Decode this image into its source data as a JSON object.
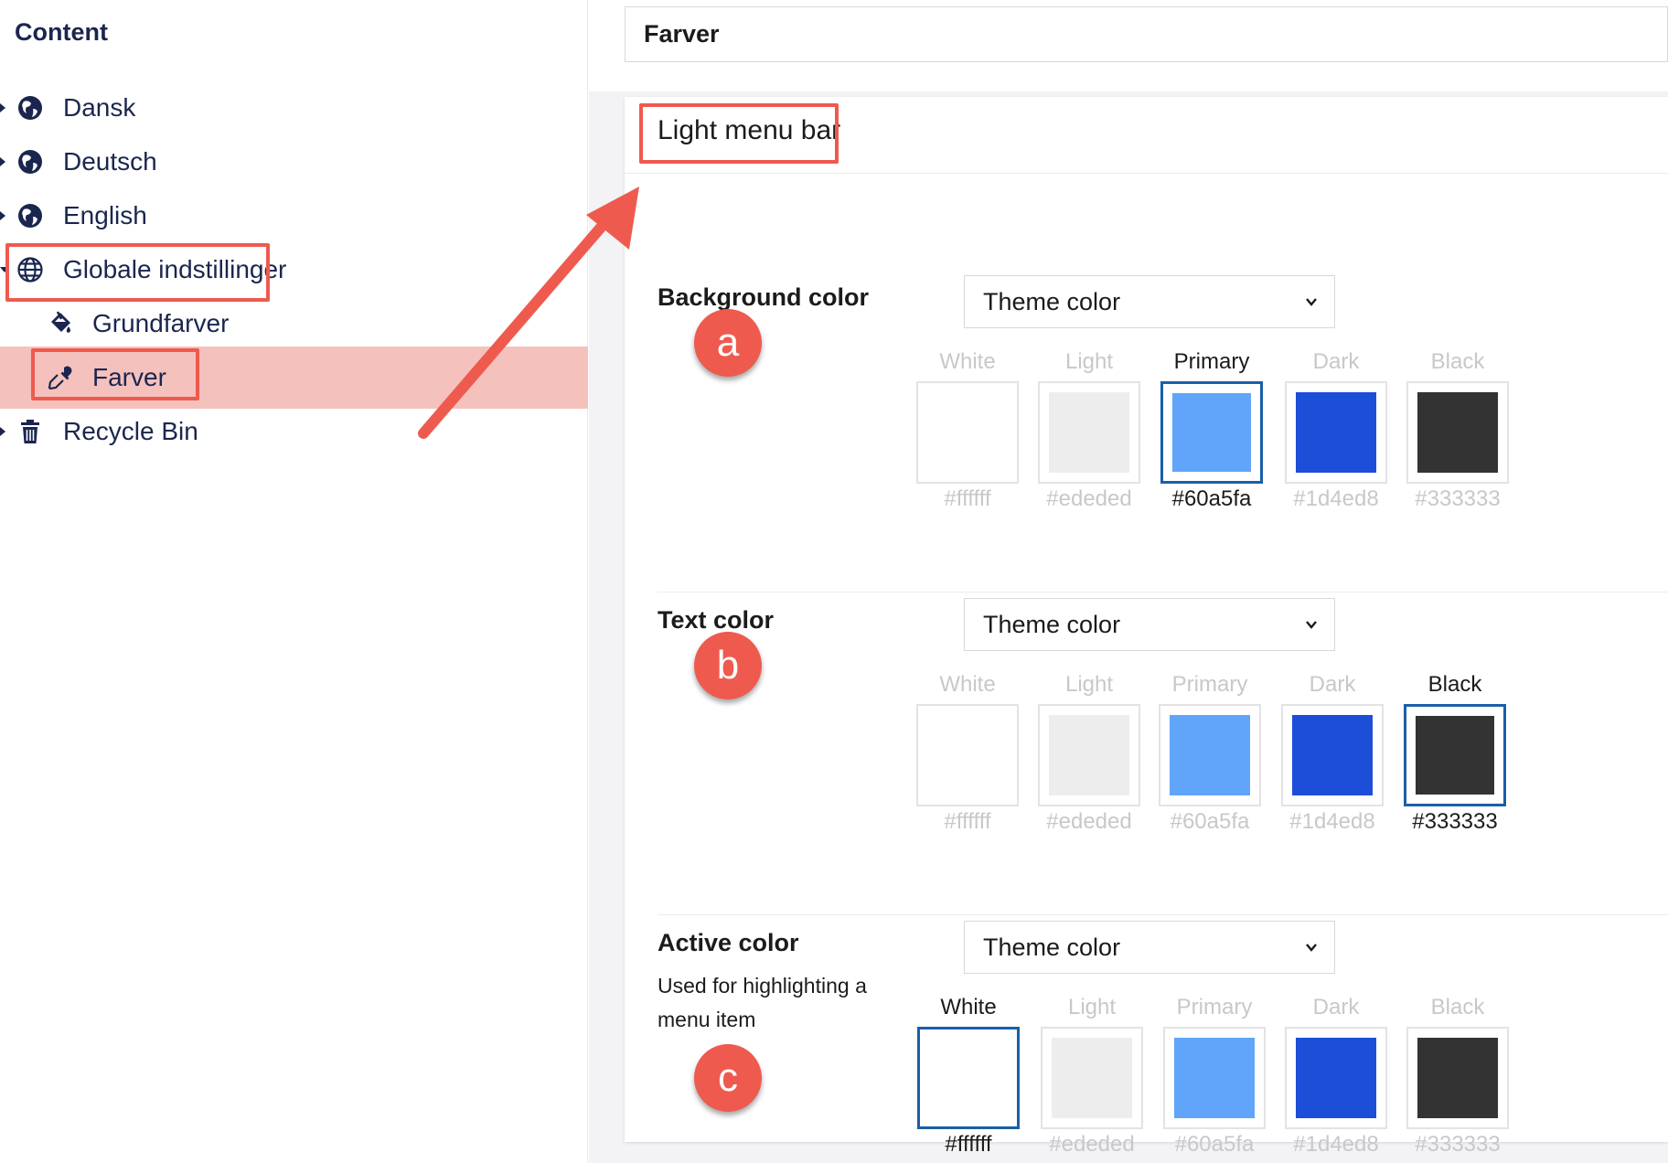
{
  "tree": {
    "title": "Content",
    "items": [
      {
        "label": "Dansk",
        "icon": "globe-icon"
      },
      {
        "label": "Deutsch",
        "icon": "globe-icon"
      },
      {
        "label": "English",
        "icon": "globe-icon"
      },
      {
        "label": "Globale indstillinger",
        "icon": "globe-grid-icon"
      },
      {
        "label": "Grundfarver",
        "icon": "paint-bucket-icon"
      },
      {
        "label": "Farver",
        "icon": "eyedropper-icon",
        "selected": true
      },
      {
        "label": "Recycle Bin",
        "icon": "trash-icon"
      }
    ]
  },
  "editor": {
    "node_name": "Farver",
    "group_title": "Light menu bar",
    "properties": [
      {
        "label": "Background color",
        "description": "",
        "select_value": "Theme color",
        "badge": "a",
        "swatches": [
          {
            "name": "White",
            "hex": "#ffffff",
            "selected": false
          },
          {
            "name": "Light",
            "hex": "#ededed",
            "selected": false
          },
          {
            "name": "Primary",
            "hex": "#60a5fa",
            "selected": true
          },
          {
            "name": "Dark",
            "hex": "#1d4ed8",
            "selected": false
          },
          {
            "name": "Black",
            "hex": "#333333",
            "selected": false
          }
        ]
      },
      {
        "label": "Text color",
        "description": "",
        "select_value": "Theme color",
        "badge": "b",
        "swatches": [
          {
            "name": "White",
            "hex": "#ffffff",
            "selected": false
          },
          {
            "name": "Light",
            "hex": "#ededed",
            "selected": false
          },
          {
            "name": "Primary",
            "hex": "#60a5fa",
            "selected": false
          },
          {
            "name": "Dark",
            "hex": "#1d4ed8",
            "selected": false
          },
          {
            "name": "Black",
            "hex": "#333333",
            "selected": true
          }
        ]
      },
      {
        "label": "Active color",
        "description": "Used for highlighting a menu item",
        "select_value": "Theme color",
        "badge": "c",
        "swatches": [
          {
            "name": "White",
            "hex": "#ffffff",
            "selected": true
          },
          {
            "name": "Light",
            "hex": "#ededed",
            "selected": false
          },
          {
            "name": "Primary",
            "hex": "#60a5fa",
            "selected": false
          },
          {
            "name": "Dark",
            "hex": "#1d4ed8",
            "selected": false
          },
          {
            "name": "Black",
            "hex": "#333333",
            "selected": false
          }
        ]
      }
    ]
  },
  "colors": {
    "annotation": "#ef5a4f",
    "selection_highlight": "#f5c1bc",
    "selected_swatch_border": "#1b5fa7",
    "tree_text": "#1b264f"
  }
}
